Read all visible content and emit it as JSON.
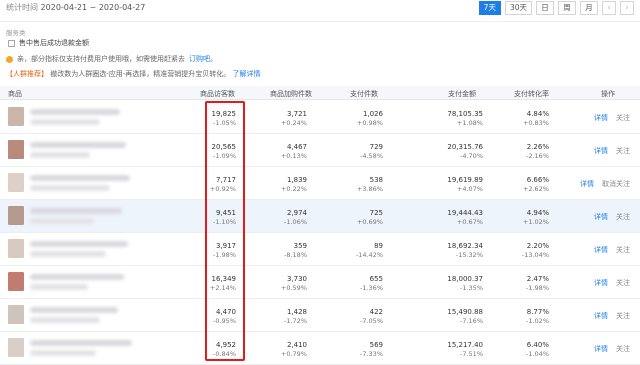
{
  "header": {
    "period_label": "统计时间",
    "period_value": "2020-04-21 ~ 2020-04-27",
    "range_buttons": [
      "7天",
      "30天",
      "日",
      "周",
      "月"
    ],
    "prev_icon": "chevron-left-icon",
    "next_icon": "chevron-right-icon"
  },
  "service": {
    "title": "服务类",
    "checkbox_label": "售中售后成功退款金额"
  },
  "notice": {
    "text": "亲，部分指标仅支持付费用户使用哦，如需使用赶紧去",
    "link": "订购吧。"
  },
  "recommend": {
    "tag": "【人群推荐】",
    "text": "撤改数为人群圈选-应用-再选择，精准营销提升宝贝转化。",
    "link": "了解详情"
  },
  "table": {
    "headers": [
      "商品",
      "商品访客数",
      "商品加购件数",
      "支付件数",
      "支付金额",
      "支付转化率",
      "操作"
    ],
    "rows": [
      {
        "visitors": "19,825",
        "visitors_d": "-1.05%",
        "cart": "3,721",
        "cart_d": "+0.24%",
        "pay_qty": "1,026",
        "pay_qty_d": "+0.98%",
        "amount": "78,105.35",
        "amount_d": "+1.08%",
        "rate": "4.84%",
        "rate_d": "+0.83%",
        "ops": [
          "详情",
          "关注"
        ]
      },
      {
        "visitors": "20,565",
        "visitors_d": "-1.09%",
        "cart": "4,467",
        "cart_d": "+0.13%",
        "pay_qty": "729",
        "pay_qty_d": "-4.58%",
        "amount": "20,315.76",
        "amount_d": "-4.70%",
        "rate": "2.26%",
        "rate_d": "-2.16%",
        "ops": [
          "详情",
          "关注"
        ]
      },
      {
        "visitors": "7,717",
        "visitors_d": "+0.92%",
        "cart": "1,839",
        "cart_d": "+0.22%",
        "pay_qty": "538",
        "pay_qty_d": "+3.86%",
        "amount": "19,619.89",
        "amount_d": "+4.07%",
        "rate": "6.66%",
        "rate_d": "+2.62%",
        "ops": [
          "详情",
          "取消关注"
        ]
      },
      {
        "visitors": "9,451",
        "visitors_d": "-1.10%",
        "cart": "2,974",
        "cart_d": "-1.06%",
        "pay_qty": "725",
        "pay_qty_d": "+0.69%",
        "amount": "19,444.43",
        "amount_d": "+0.67%",
        "rate": "4.94%",
        "rate_d": "+1.02%",
        "ops": [
          "详情",
          "关注"
        ]
      },
      {
        "visitors": "3,917",
        "visitors_d": "-1.98%",
        "cart": "359",
        "cart_d": "-8.18%",
        "pay_qty": "89",
        "pay_qty_d": "-14.42%",
        "amount": "18,692.34",
        "amount_d": "-15.32%",
        "rate": "2.20%",
        "rate_d": "-13.04%",
        "ops": [
          "详情",
          "关注"
        ]
      },
      {
        "visitors": "16,349",
        "visitors_d": "+2.14%",
        "cart": "3,730",
        "cart_d": "+0.59%",
        "pay_qty": "655",
        "pay_qty_d": "-1.36%",
        "amount": "18,000.37",
        "amount_d": "-1.35%",
        "rate": "2.47%",
        "rate_d": "-1.98%",
        "ops": [
          "详情",
          "关注"
        ]
      },
      {
        "visitors": "4,470",
        "visitors_d": "-0.95%",
        "cart": "1,428",
        "cart_d": "-1.72%",
        "pay_qty": "422",
        "pay_qty_d": "-7.05%",
        "amount": "15,490.88",
        "amount_d": "-7.16%",
        "rate": "8.77%",
        "rate_d": "-1.02%",
        "ops": [
          "详情",
          "关注"
        ]
      },
      {
        "visitors": "4,952",
        "visitors_d": "-0.84%",
        "cart": "2,410",
        "cart_d": "+0.79%",
        "pay_qty": "569",
        "pay_qty_d": "-7.33%",
        "amount": "15,217.40",
        "amount_d": "-7.51%",
        "rate": "6.40%",
        "rate_d": "-1.04%",
        "ops": [
          "详情",
          "关注"
        ]
      }
    ]
  },
  "colors": {
    "accent": "#1f7de6",
    "highlight_box": "#e11a1a"
  }
}
